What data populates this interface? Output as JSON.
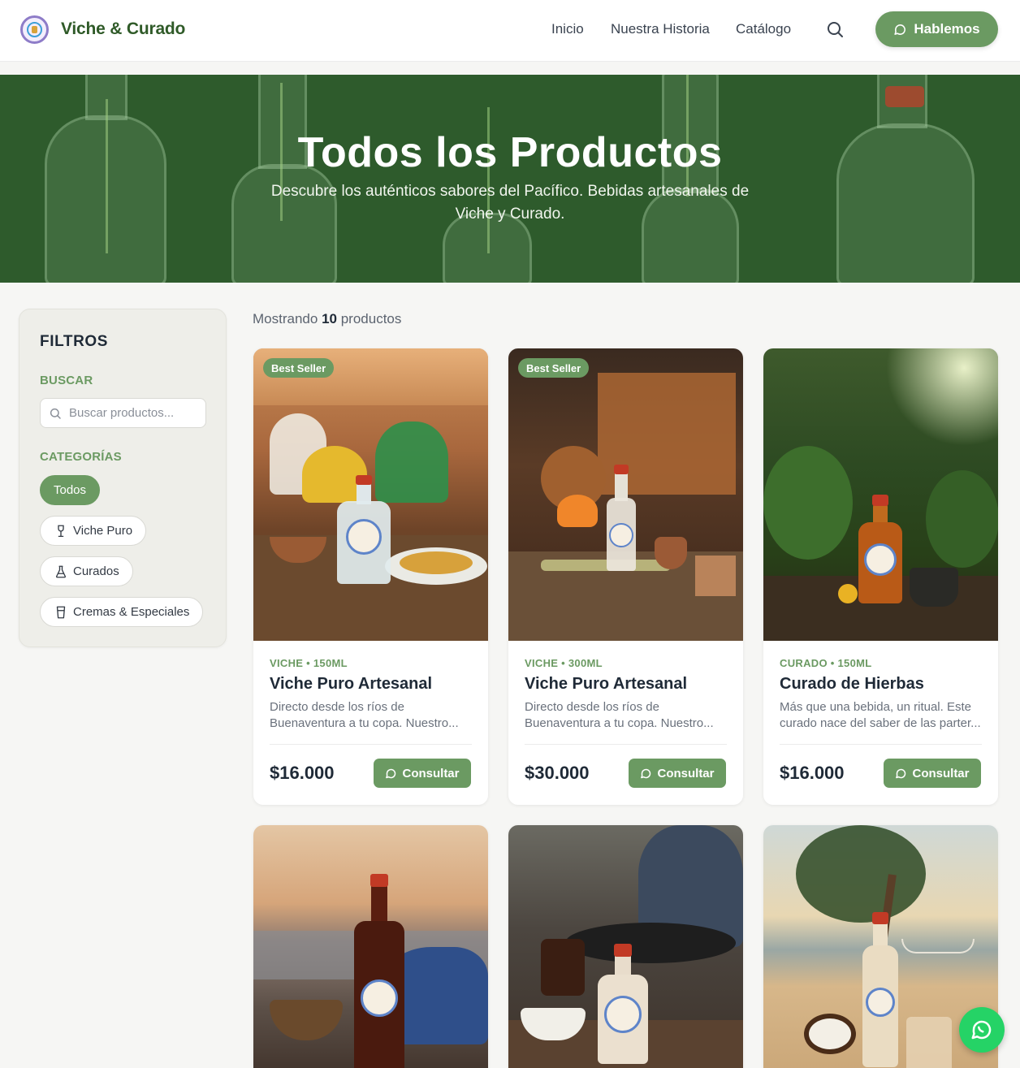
{
  "header": {
    "brand": "Viche & Curado",
    "nav": [
      "Inicio",
      "Nuestra Historia",
      "Catálogo"
    ],
    "cta_label": "Hablemos",
    "accent_color": "#6b9a62",
    "brand_color": "#2f5a28"
  },
  "hero": {
    "title": "Todos los Productos",
    "subtitle": "Descubre los auténticos sabores del Pacífico. Bebidas artesanales de Viche y Curado."
  },
  "filters": {
    "title": "FILTROS",
    "search_label": "BUSCAR",
    "search_placeholder": "Buscar productos...",
    "categories_label": "CATEGORÍAS",
    "categories": [
      {
        "label": "Todos",
        "active": true,
        "icon": "none"
      },
      {
        "label": "Viche Puro",
        "active": false,
        "icon": "wine-glass-icon"
      },
      {
        "label": "Curados",
        "active": false,
        "icon": "flask-icon"
      },
      {
        "label": "Cremas & Especiales",
        "active": false,
        "icon": "cup-icon"
      }
    ]
  },
  "results": {
    "prefix": "Mostrando",
    "count": "10",
    "suffix": "productos"
  },
  "products": [
    {
      "badge": "Best Seller",
      "meta": "VICHE • 150ML",
      "name": "Viche Puro Artesanal",
      "description": "Directo desde los ríos de Buenaventura a tu copa. Nuestro...",
      "price": "$16.000",
      "button": "Consultar"
    },
    {
      "badge": "Best Seller",
      "meta": "VICHE • 300ML",
      "name": "Viche Puro Artesanal",
      "description": "Directo desde los ríos de Buenaventura a tu copa. Nuestro...",
      "price": "$30.000",
      "button": "Consultar"
    },
    {
      "badge": "",
      "meta": "CURADO • 150ML",
      "name": "Curado de Hierbas",
      "description": "Más que una bebida, un ritual. Este curado nace del saber de las parter...",
      "price": "$16.000",
      "button": "Consultar"
    }
  ]
}
